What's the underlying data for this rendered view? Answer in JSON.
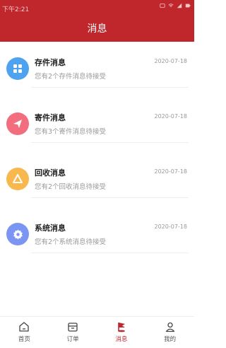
{
  "status_bar": {
    "time": "下午2:21"
  },
  "header": {
    "title": "消息",
    "background": "#c0272d"
  },
  "messages": [
    {
      "title": "存件消息",
      "date": "2020-07-18",
      "desc": "您有2个存件消息待接受",
      "icon": "grid-icon",
      "color": "#4da3f0"
    },
    {
      "title": "寄件消息",
      "date": "2020-07-18",
      "desc": "您有3个寄件消息待接受",
      "icon": "paper-plane-icon",
      "color": "#f26d7d"
    },
    {
      "title": "回收消息",
      "date": "2020-07-18",
      "desc": "您有2个回收消息待接受",
      "icon": "recycle-icon",
      "color": "#f8b84e"
    },
    {
      "title": "系统消息",
      "date": "2020-07-18",
      "desc": "您有2个系统消息待接受",
      "icon": "gear-icon",
      "color": "#7b96f2"
    }
  ],
  "tabbar": {
    "tabs": [
      {
        "label": "首页",
        "icon": "home-icon",
        "active": false
      },
      {
        "label": "订单",
        "icon": "box-icon",
        "active": false
      },
      {
        "label": "消息",
        "icon": "flag-icon",
        "active": true
      },
      {
        "label": "我的",
        "icon": "user-icon",
        "active": false
      }
    ]
  }
}
